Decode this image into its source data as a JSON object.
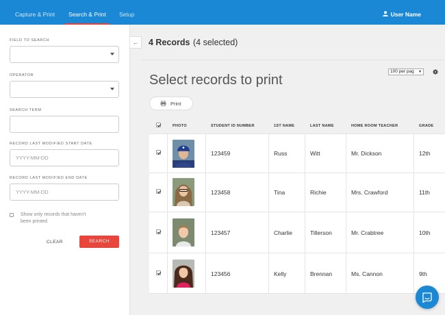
{
  "nav": {
    "tabs": [
      {
        "label": "Capture & Print",
        "active": false
      },
      {
        "label": "Search & Print",
        "active": true
      },
      {
        "label": "Setup",
        "active": false
      }
    ],
    "user_label": "User Name",
    "user_icon": "user-icon"
  },
  "sidebar": {
    "field_to_search": {
      "label": "FIELD TO SEARCH",
      "value": ""
    },
    "operator": {
      "label": "OPERATOR",
      "value": ""
    },
    "search_term": {
      "label": "SEARCH TERM",
      "value": ""
    },
    "start_date": {
      "label": "RECORD LAST MODIFIED START DATE",
      "placeholder": "YYYY-MM-DD",
      "value": ""
    },
    "end_date": {
      "label": "RECORD LAST MODIFIED END DATE",
      "placeholder": "YYYY-MM-DD",
      "value": ""
    },
    "unprinted_only": {
      "label": "Show only records that haven't been printed.",
      "checked": false
    },
    "clear_label": "CLEAR",
    "search_label": "SEARCH"
  },
  "colors": {
    "topbar": "#1a88d4",
    "accent": "#e8453c"
  },
  "records": {
    "count_label": "4 Records",
    "selected_label": "(4 selected)",
    "title": "Select records to print",
    "print_label": "Print",
    "print_icon": "printer-icon",
    "per_page": "100 per pag",
    "settings_icon": "gear-icon"
  },
  "table": {
    "columns": [
      "PHOTO",
      "STUDENT ID NUMBER",
      "1ST NAME",
      "LAST NAME",
      "HOME ROOM TEACHER",
      "GRADE"
    ],
    "all_selected": true,
    "rows": [
      {
        "selected": true,
        "student_id": "123459",
        "first": "Russ",
        "last": "Witt",
        "teacher": "Mr. Dickson",
        "grade": "12th"
      },
      {
        "selected": true,
        "student_id": "123458",
        "first": "Tina",
        "last": "Richie",
        "teacher": "Mrs. Crawford",
        "grade": "11th"
      },
      {
        "selected": true,
        "student_id": "123457",
        "first": "Charlie",
        "last": "Tillerson",
        "teacher": "Mr. Crabtree",
        "grade": "10th"
      },
      {
        "selected": true,
        "student_id": "123456",
        "first": "Kelly",
        "last": "Brennan",
        "teacher": "Ms. Cannon",
        "grade": "9th"
      }
    ]
  },
  "chat_icon": "chat-icon"
}
